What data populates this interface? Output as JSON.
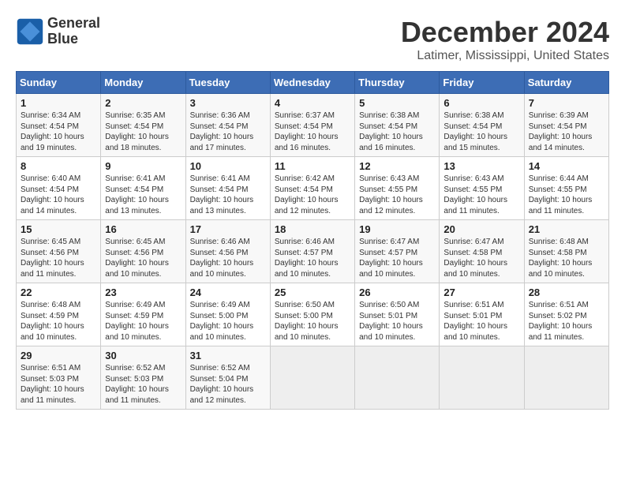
{
  "header": {
    "logo_line1": "General",
    "logo_line2": "Blue",
    "title": "December 2024",
    "subtitle": "Latimer, Mississippi, United States"
  },
  "calendar": {
    "columns": [
      "Sunday",
      "Monday",
      "Tuesday",
      "Wednesday",
      "Thursday",
      "Friday",
      "Saturday"
    ],
    "weeks": [
      [
        {
          "day": "",
          "info": ""
        },
        {
          "day": "2",
          "info": "Sunrise: 6:35 AM\nSunset: 4:54 PM\nDaylight: 10 hours\nand 18 minutes."
        },
        {
          "day": "3",
          "info": "Sunrise: 6:36 AM\nSunset: 4:54 PM\nDaylight: 10 hours\nand 17 minutes."
        },
        {
          "day": "4",
          "info": "Sunrise: 6:37 AM\nSunset: 4:54 PM\nDaylight: 10 hours\nand 16 minutes."
        },
        {
          "day": "5",
          "info": "Sunrise: 6:38 AM\nSunset: 4:54 PM\nDaylight: 10 hours\nand 16 minutes."
        },
        {
          "day": "6",
          "info": "Sunrise: 6:38 AM\nSunset: 4:54 PM\nDaylight: 10 hours\nand 15 minutes."
        },
        {
          "day": "7",
          "info": "Sunrise: 6:39 AM\nSunset: 4:54 PM\nDaylight: 10 hours\nand 14 minutes."
        }
      ],
      [
        {
          "day": "8",
          "info": "Sunrise: 6:40 AM\nSunset: 4:54 PM\nDaylight: 10 hours\nand 14 minutes."
        },
        {
          "day": "9",
          "info": "Sunrise: 6:41 AM\nSunset: 4:54 PM\nDaylight: 10 hours\nand 13 minutes."
        },
        {
          "day": "10",
          "info": "Sunrise: 6:41 AM\nSunset: 4:54 PM\nDaylight: 10 hours\nand 13 minutes."
        },
        {
          "day": "11",
          "info": "Sunrise: 6:42 AM\nSunset: 4:54 PM\nDaylight: 10 hours\nand 12 minutes."
        },
        {
          "day": "12",
          "info": "Sunrise: 6:43 AM\nSunset: 4:55 PM\nDaylight: 10 hours\nand 12 minutes."
        },
        {
          "day": "13",
          "info": "Sunrise: 6:43 AM\nSunset: 4:55 PM\nDaylight: 10 hours\nand 11 minutes."
        },
        {
          "day": "14",
          "info": "Sunrise: 6:44 AM\nSunset: 4:55 PM\nDaylight: 10 hours\nand 11 minutes."
        }
      ],
      [
        {
          "day": "15",
          "info": "Sunrise: 6:45 AM\nSunset: 4:56 PM\nDaylight: 10 hours\nand 11 minutes."
        },
        {
          "day": "16",
          "info": "Sunrise: 6:45 AM\nSunset: 4:56 PM\nDaylight: 10 hours\nand 10 minutes."
        },
        {
          "day": "17",
          "info": "Sunrise: 6:46 AM\nSunset: 4:56 PM\nDaylight: 10 hours\nand 10 minutes."
        },
        {
          "day": "18",
          "info": "Sunrise: 6:46 AM\nSunset: 4:57 PM\nDaylight: 10 hours\nand 10 minutes."
        },
        {
          "day": "19",
          "info": "Sunrise: 6:47 AM\nSunset: 4:57 PM\nDaylight: 10 hours\nand 10 minutes."
        },
        {
          "day": "20",
          "info": "Sunrise: 6:47 AM\nSunset: 4:58 PM\nDaylight: 10 hours\nand 10 minutes."
        },
        {
          "day": "21",
          "info": "Sunrise: 6:48 AM\nSunset: 4:58 PM\nDaylight: 10 hours\nand 10 minutes."
        }
      ],
      [
        {
          "day": "22",
          "info": "Sunrise: 6:48 AM\nSunset: 4:59 PM\nDaylight: 10 hours\nand 10 minutes."
        },
        {
          "day": "23",
          "info": "Sunrise: 6:49 AM\nSunset: 4:59 PM\nDaylight: 10 hours\nand 10 minutes."
        },
        {
          "day": "24",
          "info": "Sunrise: 6:49 AM\nSunset: 5:00 PM\nDaylight: 10 hours\nand 10 minutes."
        },
        {
          "day": "25",
          "info": "Sunrise: 6:50 AM\nSunset: 5:00 PM\nDaylight: 10 hours\nand 10 minutes."
        },
        {
          "day": "26",
          "info": "Sunrise: 6:50 AM\nSunset: 5:01 PM\nDaylight: 10 hours\nand 10 minutes."
        },
        {
          "day": "27",
          "info": "Sunrise: 6:51 AM\nSunset: 5:01 PM\nDaylight: 10 hours\nand 10 minutes."
        },
        {
          "day": "28",
          "info": "Sunrise: 6:51 AM\nSunset: 5:02 PM\nDaylight: 10 hours\nand 11 minutes."
        }
      ],
      [
        {
          "day": "29",
          "info": "Sunrise: 6:51 AM\nSunset: 5:03 PM\nDaylight: 10 hours\nand 11 minutes."
        },
        {
          "day": "30",
          "info": "Sunrise: 6:52 AM\nSunset: 5:03 PM\nDaylight: 10 hours\nand 11 minutes."
        },
        {
          "day": "31",
          "info": "Sunrise: 6:52 AM\nSunset: 5:04 PM\nDaylight: 10 hours\nand 12 minutes."
        },
        {
          "day": "",
          "info": ""
        },
        {
          "day": "",
          "info": ""
        },
        {
          "day": "",
          "info": ""
        },
        {
          "day": "",
          "info": ""
        }
      ]
    ],
    "week1_day1": {
      "day": "1",
      "info": "Sunrise: 6:34 AM\nSunset: 4:54 PM\nDaylight: 10 hours\nand 19 minutes."
    }
  }
}
